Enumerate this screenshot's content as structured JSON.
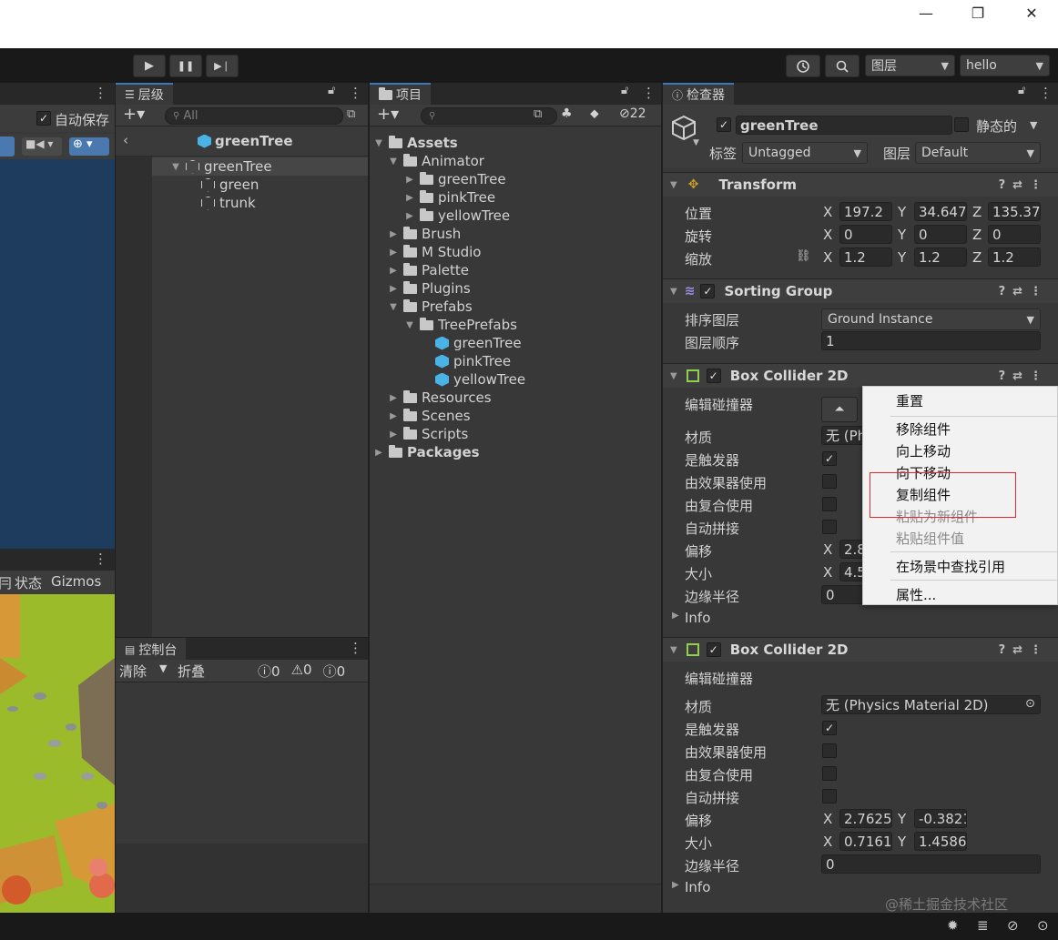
{
  "window": {
    "minimize": "—",
    "maximize": "❐",
    "close": "✕"
  },
  "toolbar": {
    "play": "▶",
    "pause": "❚❚",
    "step": "▶❘",
    "history_icon": "history-icon",
    "search_icon": "search-icon",
    "layers_label": "图层",
    "layout_label": "hello"
  },
  "scene": {
    "auto_save": "自动保存",
    "state_tab": "状态",
    "gizmos": "Gizmos",
    "col_label": "冃"
  },
  "hierarchy": {
    "title": "层级",
    "search_placeholder": "All",
    "scene_root": "greenTree",
    "items": [
      {
        "label": "greenTree"
      },
      {
        "label": "green"
      },
      {
        "label": "trunk"
      }
    ]
  },
  "project": {
    "title": "项目",
    "hidden_count": "22",
    "tree": [
      {
        "label": "Assets"
      },
      {
        "label": "Animator"
      },
      {
        "label": "greenTree"
      },
      {
        "label": "pinkTree"
      },
      {
        "label": "yellowTree"
      },
      {
        "label": "Brush"
      },
      {
        "label": "M Studio"
      },
      {
        "label": "Palette"
      },
      {
        "label": "Plugins"
      },
      {
        "label": "Prefabs"
      },
      {
        "label": "TreePrefabs"
      },
      {
        "label": "greenTree"
      },
      {
        "label": "pinkTree"
      },
      {
        "label": "yellowTree"
      },
      {
        "label": "Resources"
      },
      {
        "label": "Scenes"
      },
      {
        "label": "Scripts"
      },
      {
        "label": "Packages"
      }
    ]
  },
  "console": {
    "title": "控制台",
    "clear": "清除",
    "collapse": "折叠",
    "count_info": "0",
    "count_warn": "0",
    "count_error": "0"
  },
  "inspector": {
    "title": "检查器",
    "object_name": "greenTree",
    "static_label": "静态的",
    "tag_label": "标签",
    "tag_value": "Untagged",
    "layer_label": "图层",
    "layer_value": "Default",
    "transform": {
      "title": "Transform",
      "position_label": "位置",
      "rotation_label": "旋转",
      "scale_label": "缩放",
      "position": {
        "x": "197.2",
        "y": "34.647",
        "z": "135.37"
      },
      "rotation": {
        "x": "0",
        "y": "0",
        "z": "0"
      },
      "scale": {
        "x": "1.2",
        "y": "1.2",
        "z": "1.2"
      }
    },
    "sorting_group": {
      "title": "Sorting Group",
      "layer_label": "排序图层",
      "layer_value": "Ground Instance",
      "order_label": "图层顺序",
      "order_value": "1"
    },
    "collider1": {
      "title": "Box Collider 2D",
      "edit_label": "编辑碰撞器",
      "material_label": "材质",
      "material_value": "无 (Ph",
      "trigger_label": "是触发器",
      "effector_label": "由效果器使用",
      "composite_label": "由复合使用",
      "tiling_label": "自动拼接",
      "offset_label": "偏移",
      "offset_x": "2.8",
      "size_label": "大小",
      "size_x": "4.5",
      "edge_label": "边缘半径",
      "edge_value": "0",
      "info_label": "Info"
    },
    "collider2": {
      "title": "Box Collider 2D",
      "edit_label": "编辑碰撞器",
      "material_label": "材质",
      "material_value": "无 (Physics Material 2D)",
      "trigger_label": "是触发器",
      "effector_label": "由效果器使用",
      "composite_label": "由复合使用",
      "tiling_label": "自动拼接",
      "offset_label": "偏移",
      "offset_x": "2.7625",
      "offset_y": "-0.3821",
      "size_label": "大小",
      "size_x": "0.7161",
      "size_y": "1.4586",
      "edge_label": "边缘半径",
      "edge_value": "0",
      "info_label": "Info"
    }
  },
  "context_menu": {
    "items": [
      {
        "label": "重置"
      },
      {
        "label": "移除组件"
      },
      {
        "label": "向上移动"
      },
      {
        "label": "向下移动"
      },
      {
        "label": "复制组件"
      },
      {
        "label": "粘贴为新组件"
      },
      {
        "label": "粘贴组件值"
      },
      {
        "label": "在场景中查找引用"
      },
      {
        "label": "属性..."
      }
    ],
    "highlight_color": "#e0262f"
  },
  "watermark": "@稀土掘金技术社区",
  "colors": {
    "accent": "#3a79bb",
    "prefab_blue": "#4ab3e6",
    "collider_green": "#8fd14f"
  }
}
